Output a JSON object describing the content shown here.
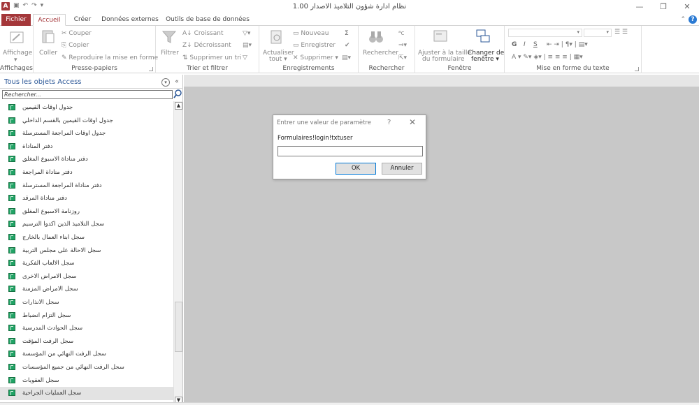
{
  "window": {
    "title": "نظام ادارة شؤون التلاميذ الاصدار 1.00",
    "app_icon": "A"
  },
  "tabs": {
    "file": "Fichier",
    "home": "Accueil",
    "create": "Créer",
    "external": "Données externes",
    "dbtools": "Outils de base de données"
  },
  "ribbon": {
    "views": {
      "affichage": "Affichage",
      "group": "Affichages"
    },
    "clipboard": {
      "paste": "Coller",
      "cut": "Couper",
      "copy": "Copier",
      "format_painter": "Reproduire la mise en forme",
      "group": "Presse-papiers"
    },
    "sort": {
      "filter": "Filtrer",
      "asc": "Croissant",
      "desc": "Décroissant",
      "remove": "Supprimer un tri",
      "group": "Trier et filtrer"
    },
    "records": {
      "refresh": "Actualiser",
      "refresh_sub": "tout",
      "new": "Nouveau",
      "save": "Enregistrer",
      "delete": "Supprimer",
      "group": "Enregistrements"
    },
    "find": {
      "find": "Rechercher",
      "group": "Rechercher"
    },
    "window": {
      "fit1": "Ajuster à la taille",
      "fit2": "du formulaire",
      "switch1": "Changer de",
      "switch2": "fenêtre",
      "group": "Fenêtre"
    },
    "text": {
      "group": "Mise en forme du texte",
      "bold": "G",
      "italic": "I",
      "underline": "S"
    }
  },
  "nav": {
    "title": "Tous les objets Access",
    "search_placeholder": "Rechercher...",
    "items": [
      {
        "label": "جدول اوقات القيمين"
      },
      {
        "label": "جدول اوقات القيمين بالقسم الداخلي"
      },
      {
        "label": "جدول اوقات المراجعة المسترسلة"
      },
      {
        "label": "دفتر المناداة"
      },
      {
        "label": "دفتر مناداة الاسبوع المغلق"
      },
      {
        "label": "دفتر مناداة المراجعة"
      },
      {
        "label": "دفتر مناداة المراجعة المسترسلة"
      },
      {
        "label": "دفتر مناداة المرقد"
      },
      {
        "label": "روزنامة الاسبوع المغلق"
      },
      {
        "label": "سجل التلاميذ الذين اكدوا الترسيم"
      },
      {
        "label": "سجل ابناء العمال بالخارج"
      },
      {
        "label": "سجل الاحالة على مجلس التربية"
      },
      {
        "label": "سجل الالعاب الفكرية"
      },
      {
        "label": "سجل الامراض الاخرى"
      },
      {
        "label": "سجل الامراض المزمنة"
      },
      {
        "label": "سجل الانذارات"
      },
      {
        "label": "سجل التزام انضباط"
      },
      {
        "label": "سجل الحوادث المدرسية"
      },
      {
        "label": "سجل الرفت المؤقت"
      },
      {
        "label": "سجل الرفت النهائي من المؤسسة"
      },
      {
        "label": "سجل الرفت النهائي من جميع المؤسسات"
      },
      {
        "label": "سجل العقوبات"
      },
      {
        "label": "سجل العمليات الجراحية"
      }
    ]
  },
  "dialog": {
    "title": "Entrer une valeur de paramètre",
    "help": "?",
    "close": "✕",
    "prompt": "Formulaires!login!txtuser",
    "value": "",
    "ok": "OK",
    "cancel": "Annuler"
  }
}
